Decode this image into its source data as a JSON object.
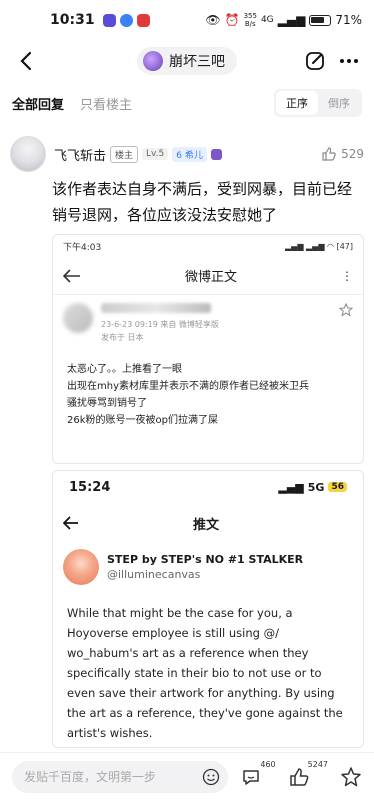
{
  "status_bar": {
    "time": "10:31",
    "speed_top": "355",
    "speed_bottom": "B/s",
    "network": "4G",
    "battery": "71%"
  },
  "header": {
    "forum_name": "崩坏三吧"
  },
  "filter": {
    "tab_all": "全部回复",
    "tab_op": "只看楼主",
    "sort_asc": "正序",
    "sort_desc": "倒序"
  },
  "post": {
    "username": "飞飞斩击",
    "badge_op": "楼主",
    "badge_level": "Lv.5",
    "badge_fan": "6 希儿",
    "likes": "529",
    "text": "该作者表达自身不满后，受到网暴，目前已经销号退网，各位应该没法安慰她了"
  },
  "screenshot1": {
    "status_time": "下午4:03",
    "status_battery": "47",
    "title": "微博正文",
    "date": "23-6-23 09:19  来自 微博轻享版",
    "location": "发布于 日本",
    "lines": [
      "太恶心了。。上推看了一眼",
      "出现在mhy素材库里并表示不满的原作者已经被米卫兵",
      "骚扰辱骂到销号了",
      "26k粉的账号一夜被op们拉满了屎"
    ]
  },
  "screenshot2": {
    "status_time": "15:24",
    "status_net": "5G",
    "status_battery": "56",
    "title": "推文",
    "name": "STEP by STEP's NO #1 STALKER",
    "handle": "@illuminecanvas",
    "body": "While that might be the case for you, a Hoyoverse employee is still using @/ wo_habum's art as a reference when they specifically state in their bio to not use or to even save their artwork for anything. By using the art as a reference, they've gone against the artist's wishes."
  },
  "bottom": {
    "placeholder": "发贴千百度，文明第一步",
    "comments": "460",
    "likes": "5247"
  }
}
